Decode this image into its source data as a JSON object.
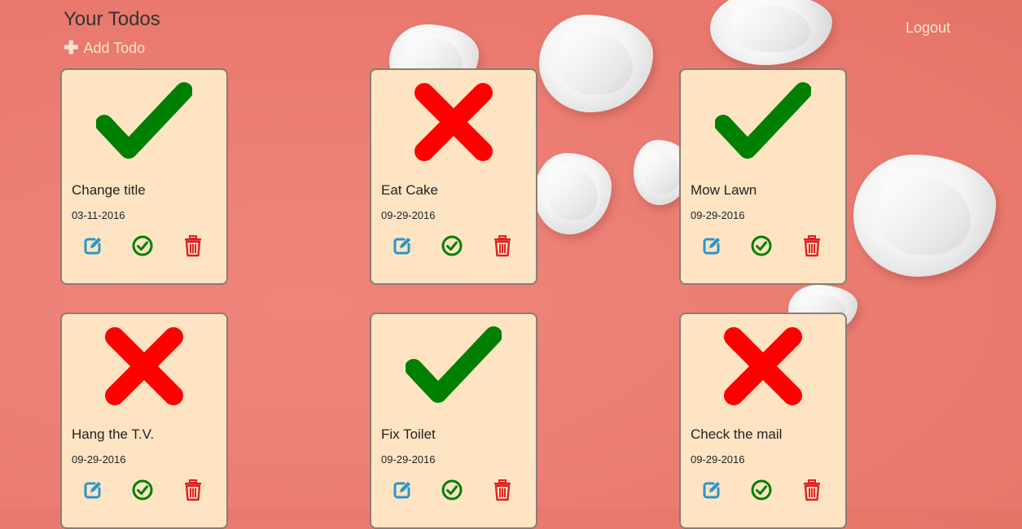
{
  "header": {
    "title": "Your Todos",
    "add_label": "Add Todo",
    "logout_label": "Logout"
  },
  "colors": {
    "done": "#008000",
    "not_done": "#ff0000",
    "edit_icon": "#2a95c8",
    "delete_icon": "#e02020",
    "card_bg": "#ffe4c4",
    "link": "#fbe5d0"
  },
  "icons": {
    "done_status": "check-icon",
    "not_done_status": "x-icon",
    "edit": "edit-icon",
    "complete": "circle-check-icon",
    "delete": "trash-icon"
  },
  "todos": [
    {
      "title": "Change title",
      "date": "03-11-2016",
      "completed": true
    },
    {
      "title": "Eat Cake",
      "date": "09-29-2016",
      "completed": false
    },
    {
      "title": "Mow Lawn",
      "date": "09-29-2016",
      "completed": true
    },
    {
      "title": "Hang the T.V.",
      "date": "09-29-2016",
      "completed": false
    },
    {
      "title": "Fix Toilet",
      "date": "09-29-2016",
      "completed": true
    },
    {
      "title": "Check the mail",
      "date": "09-29-2016",
      "completed": false
    }
  ]
}
